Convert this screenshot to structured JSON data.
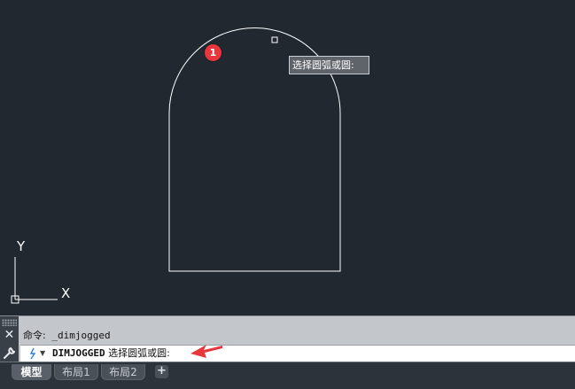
{
  "canvas": {
    "background_color": "#212830",
    "ucs_icon": {
      "y_label": "Y",
      "x_label": "X"
    },
    "cursor_tooltip": "选择圆弧或圆:",
    "step_badge": "1",
    "arrow_color": "#e8373c"
  },
  "command_line": {
    "history_prefix": "命令:",
    "history_command": "_dimjogged",
    "prompt_keyword": "DIMJOGGED",
    "prompt_text": "选择圆弧或圆:",
    "close_icon": "close-icon",
    "customize_icon": "wrench-icon",
    "command_icon": "command-icon"
  },
  "layout_tabs": {
    "tabs": [
      {
        "label": "模型",
        "active": true
      },
      {
        "label": "布局1",
        "active": false
      },
      {
        "label": "布局2",
        "active": false
      }
    ],
    "add_label": "+"
  }
}
